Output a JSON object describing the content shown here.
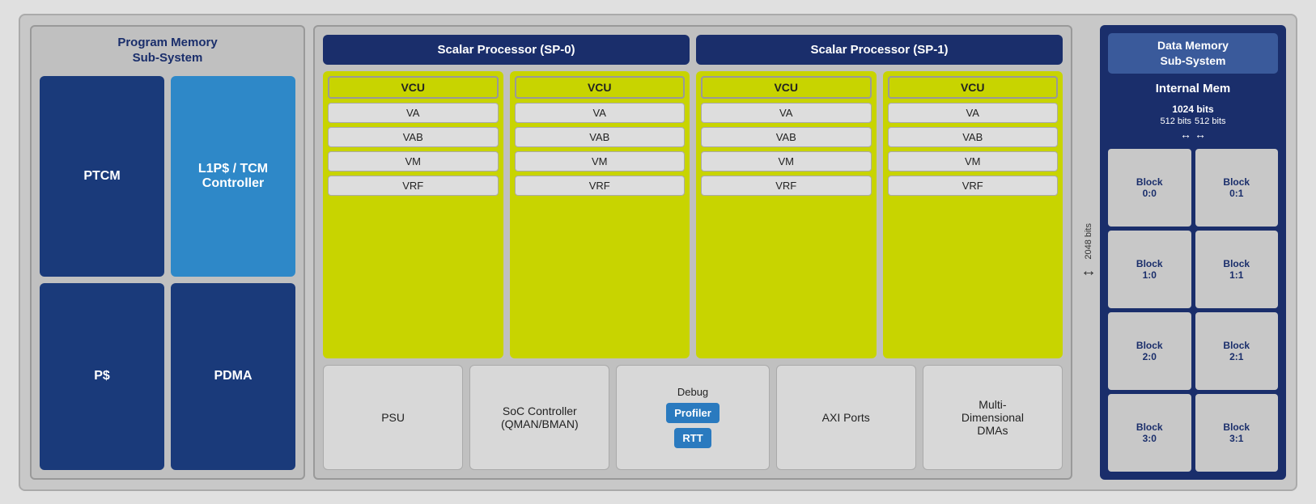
{
  "left_panel": {
    "title": "Program Memory\nSub-System",
    "blocks": [
      {
        "label": "PTCM",
        "style": "dark"
      },
      {
        "label": "L1P$ / TCM\nController",
        "style": "light"
      },
      {
        "label": "P$",
        "style": "dark"
      },
      {
        "label": "PDMA",
        "style": "dark"
      }
    ]
  },
  "center_panel": {
    "sp0_label": "Scalar Processor (SP-0)",
    "sp1_label": "Scalar Processor (SP-1)",
    "vcu_groups": [
      {
        "id": "vcu0",
        "label": "VCU",
        "sub_items": [
          "VA",
          "VAB",
          "VM",
          "VRF"
        ]
      },
      {
        "id": "vcu1",
        "label": "VCU",
        "sub_items": [
          "VA",
          "VAB",
          "VM",
          "VRF"
        ]
      },
      {
        "id": "vcu2",
        "label": "VCU",
        "sub_items": [
          "VA",
          "VAB",
          "VM",
          "VRF"
        ]
      },
      {
        "id": "vcu3",
        "label": "VCU",
        "sub_items": [
          "VA",
          "VAB",
          "VM",
          "VRF"
        ]
      }
    ],
    "bottom_blocks": [
      {
        "id": "psu",
        "label": "PSU"
      },
      {
        "id": "soc",
        "label": "SoC Controller\n(QMAN/BMAN)"
      },
      {
        "id": "debug",
        "type": "debug",
        "title": "Debug",
        "profiler": "Profiler",
        "rtt": "RTT"
      },
      {
        "id": "axi",
        "label": "AXI Ports"
      },
      {
        "id": "dma",
        "label": "Multi-\nDimensional\nDMAs"
      }
    ]
  },
  "right_panel": {
    "section_title": "Data Memory\nSub-System",
    "internal_mem_label": "Internal Mem",
    "bits_2048": "2048\nbits",
    "bits_1024": "1024 bits",
    "bits_512_left": "512 bits",
    "bits_512_right": "512 bits",
    "mem_blocks": [
      {
        "label": "Block\n0:0"
      },
      {
        "label": "Block\n0:1"
      },
      {
        "label": "Block\n1:0"
      },
      {
        "label": "Block\n1:1"
      },
      {
        "label": "Block\n2:0"
      },
      {
        "label": "Block\n2:1"
      },
      {
        "label": "Block\n3:0"
      },
      {
        "label": "Block\n3:1"
      }
    ]
  }
}
